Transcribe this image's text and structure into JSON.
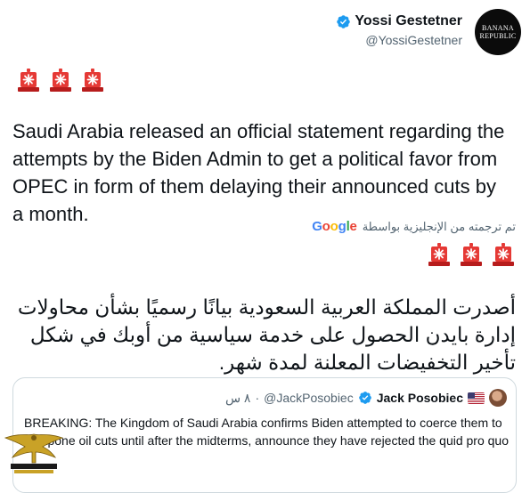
{
  "author": {
    "display_name": "Yossi Gestetner",
    "handle": "@YossiGestetner",
    "avatar_text_line1": "BANANA",
    "avatar_text_line2": "REPUBLIC"
  },
  "tweet": {
    "text": "Saudi Arabia released an official statement regarding the attempts by the Biden Admin to get a political favor from OPEC in form of them delaying their announced cuts by a month.",
    "translation_label": "تم ترجمته من الإنجليزية بواسطة",
    "translation_provider": "Google",
    "translated_text": "أصدرت المملكة العربية السعودية بيانًا رسميًا بشأن محاولات إدارة بايدن الحصول على خدمة سياسية من أوبك في شكل تأخير التخفيضات المعلنة لمدة شهر."
  },
  "quoted_tweet": {
    "display_name": "Jack Posobiec",
    "flag": "us-flag-icon",
    "handle": "@JackPosobiec",
    "separator": "·",
    "time": "٨ س",
    "text": "BREAKING: The Kingdom of Saudi Arabia confirms Biden attempted to coerce them to postpone oil cuts until after the midterms, announce they have rejected the quid pro quo"
  },
  "icons": {
    "siren": "police-siren-icon",
    "verified": "verified-badge-icon"
  },
  "colors": {
    "verified_blue": "#1d9bf0",
    "siren_red": "#d32f2f",
    "secondary_text": "#536471",
    "border": "#cfd9de"
  }
}
